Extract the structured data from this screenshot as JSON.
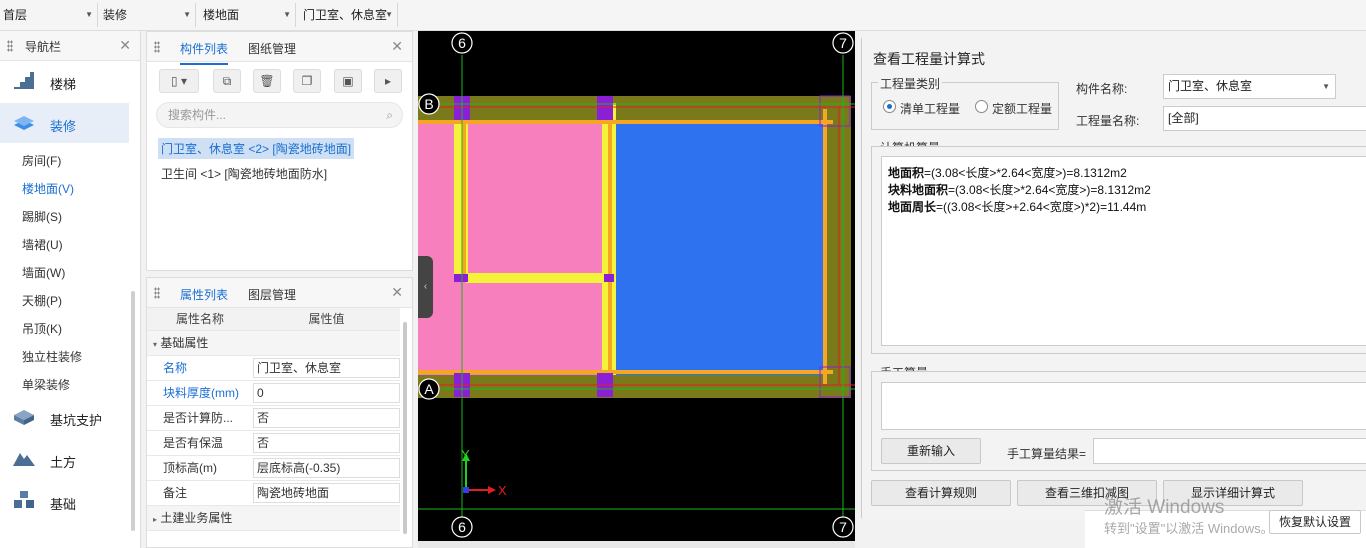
{
  "topbar": {
    "floor": "首层",
    "category": "装修",
    "type": "楼地面",
    "component": "门卫室、休息室"
  },
  "nav": {
    "title": "导航栏",
    "categories": [
      {
        "label": "楼梯",
        "icon": "stairs-icon"
      },
      {
        "label": "装修",
        "icon": "decoration-icon"
      },
      {
        "label": "基坑支护",
        "icon": "pit-support-icon"
      },
      {
        "label": "土方",
        "icon": "earthwork-icon"
      },
      {
        "label": "基础",
        "icon": "foundation-icon"
      }
    ],
    "sub_items": [
      "房间(F)",
      "楼地面(V)",
      "踢脚(S)",
      "墙裙(U)",
      "墙面(W)",
      "天棚(P)",
      "吊顶(K)",
      "独立柱装修",
      "单梁装修"
    ]
  },
  "component_panel": {
    "tab_active": "构件列表",
    "tab_other": "图纸管理",
    "search_placeholder": "搜索构件...",
    "items": [
      "门卫室、休息室 <2> [陶瓷地砖地面]",
      "卫生间 <1> [陶瓷地砖地面防水]"
    ]
  },
  "attr_panel": {
    "tab_active": "属性列表",
    "tab_other": "图层管理",
    "col_name": "属性名称",
    "col_value": "属性值",
    "group1": "基础属性",
    "rows": [
      {
        "name": "名称",
        "value": "门卫室、休息室"
      },
      {
        "name": "块料厚度(mm)",
        "value": "0"
      },
      {
        "name": "是否计算防...",
        "value": "否"
      },
      {
        "name": "是否有保温",
        "value": "否"
      },
      {
        "name": "顶标高(m)",
        "value": "层底标高(-0.35)"
      },
      {
        "name": "备注",
        "value": "陶瓷地砖地面"
      }
    ],
    "group2": "土建业务属性"
  },
  "canvas": {
    "axis_top_left": "6",
    "axis_top_right": "7",
    "axis_bottom_left": "6",
    "axis_bottom_right": "7",
    "axis_B": "B",
    "axis_A": "A",
    "x_label": "X",
    "y_label": "Y",
    "colors": {
      "pink": "#f77fbe",
      "blue": "#2f72f0",
      "olive": "#7a7a1a",
      "yellow": "#f5f23a",
      "orange": "#f5a623",
      "purple": "#8a1fd6"
    }
  },
  "dialog": {
    "title": "查看工程量计算式",
    "qty_type_label": "工程量类别",
    "radio_list": "清单工程量",
    "radio_quota": "定额工程量",
    "comp_name_label": "构件名称:",
    "comp_name_value": "门卫室、休息室",
    "qty_name_label": "工程量名称:",
    "qty_name_value": "[全部]",
    "computer_label": "计算机算量",
    "formulas": [
      {
        "name": "地面积",
        "expr": "=(3.08<长度>*2.64<宽度>)=8.1312m2"
      },
      {
        "name": "块料地面积",
        "expr": "=(3.08<长度>*2.64<宽度>)=8.1312m2"
      },
      {
        "name": "地面周长",
        "expr": "=((3.08<长度>+2.64<宽度>)*2)=11.44m"
      }
    ],
    "manual_label": "手工算量",
    "reenter_btn": "重新输入",
    "manual_result_label": "手工算量结果=",
    "btn_rules": "查看计算规则",
    "btn_3d": "查看三维扣减图",
    "btn_detail": "显示详细计算式",
    "btn_restore": "恢复默认设置",
    "watermark1": "激活 Windows",
    "watermark2": "转到\"设置\"以激活 Windows。"
  }
}
